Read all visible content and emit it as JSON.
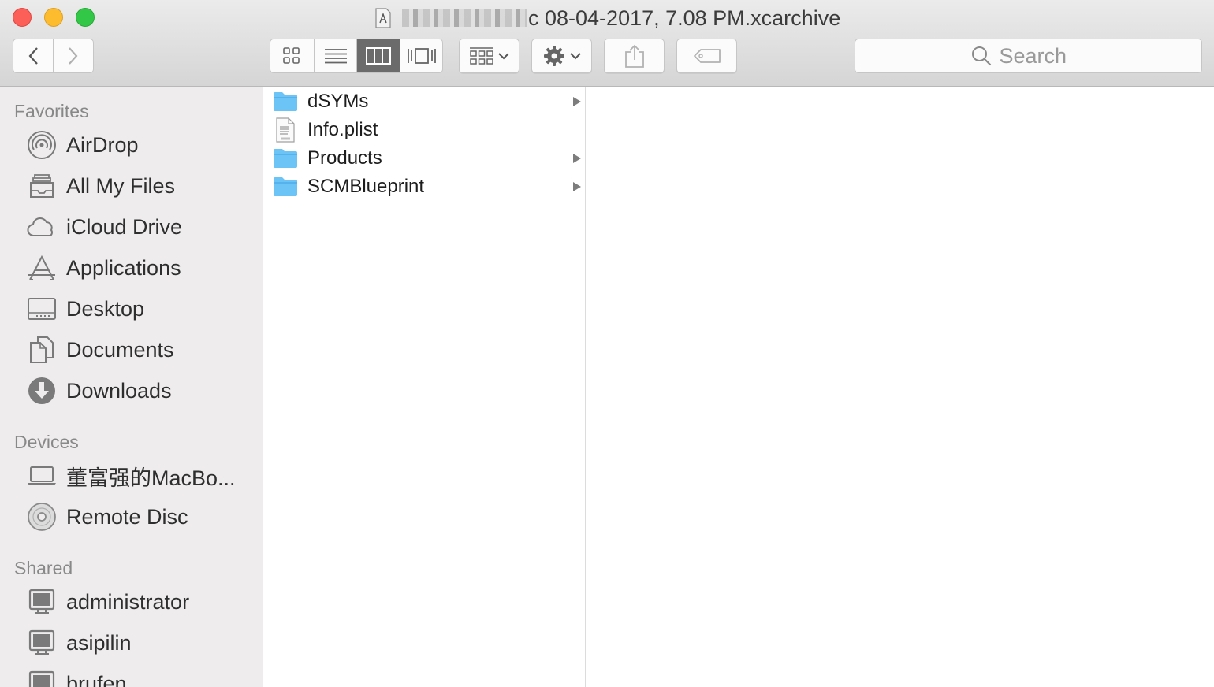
{
  "window": {
    "title": "c 08-04-2017, 7.08 PM.xcarchive"
  },
  "toolbar": {
    "back_icon": "chevron-left-icon",
    "forward_icon": "chevron-right-icon",
    "view_modes": [
      "icon-view",
      "list-view",
      "column-view",
      "cover-flow-view"
    ],
    "active_view": "column-view",
    "arrange_icon": "arrange-grid-icon",
    "action_icon": "gear-icon",
    "share_icon": "share-icon",
    "tag_icon": "tag-icon"
  },
  "search": {
    "placeholder": "Search"
  },
  "sidebar": {
    "favorites_heading": "Favorites",
    "favorites": [
      {
        "label": "AirDrop",
        "icon": "airdrop-icon"
      },
      {
        "label": "All My Files",
        "icon": "all-files-icon"
      },
      {
        "label": "iCloud Drive",
        "icon": "cloud-icon"
      },
      {
        "label": "Applications",
        "icon": "applications-icon"
      },
      {
        "label": "Desktop",
        "icon": "desktop-icon"
      },
      {
        "label": "Documents",
        "icon": "documents-icon"
      },
      {
        "label": "Downloads",
        "icon": "downloads-icon"
      }
    ],
    "devices_heading": "Devices",
    "devices": [
      {
        "label": "董富强的MacBo...",
        "icon": "laptop-icon"
      },
      {
        "label": "Remote Disc",
        "icon": "disc-icon"
      }
    ],
    "shared_heading": "Shared",
    "shared": [
      {
        "label": "administrator",
        "icon": "computer-icon"
      },
      {
        "label": "asipilin",
        "icon": "computer-icon"
      },
      {
        "label": "brufen",
        "icon": "computer-icon"
      }
    ]
  },
  "browser": {
    "column1": [
      {
        "name": "dSYMs",
        "kind": "folder",
        "has_children": true
      },
      {
        "name": "Info.plist",
        "kind": "plist",
        "has_children": false
      },
      {
        "name": "Products",
        "kind": "folder",
        "has_children": true
      },
      {
        "name": "SCMBlueprint",
        "kind": "folder",
        "has_children": true
      }
    ]
  },
  "colors": {
    "folder": "#6cc3f5",
    "sidebar_bg": "#eeeced",
    "active_segment": "#6b6b6b"
  }
}
